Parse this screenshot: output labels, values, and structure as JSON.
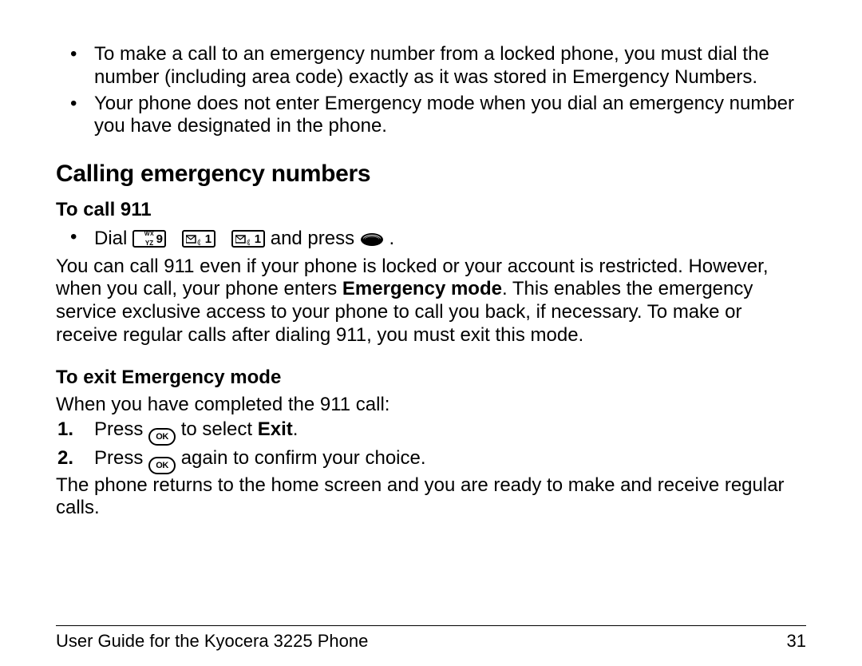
{
  "intro_bullets": [
    "To make a call to an emergency number from a locked phone, you must dial the number (including area code) exactly as it was stored in Emergency Numbers.",
    "Your phone does not enter Emergency mode when you dial an emergency number you have designated in the phone."
  ],
  "h1": "Calling emergency numbers",
  "to_call": {
    "heading": "To call 911",
    "dial_prefix": "Dial ",
    "dial_suffix": " and press ",
    "dial_end": " .",
    "para_before_bold": "You can call 911 even if your phone is locked or your account is restricted. However, when you call, your phone enters ",
    "bold": "Emergency mode",
    "para_after_bold": ". This enables the emergency service exclusive access to your phone to call you back, if necessary. To make or receive regular calls after dialing 911, you must exit this mode."
  },
  "to_exit": {
    "heading": "To exit Emergency mode",
    "intro": "When you have completed the 911 call:",
    "step1_before": "Press ",
    "step1_mid": " to select ",
    "step1_bold": "Exit",
    "step1_after": ".",
    "step2_before": "Press ",
    "step2_after": " again to confirm your choice.",
    "outro": "The phone returns to the home screen and you are ready to make and receive regular calls."
  },
  "footer": {
    "left": "User Guide for the Kyocera 3225 Phone",
    "right": "31"
  },
  "keys": {
    "ok_label": "OK"
  }
}
